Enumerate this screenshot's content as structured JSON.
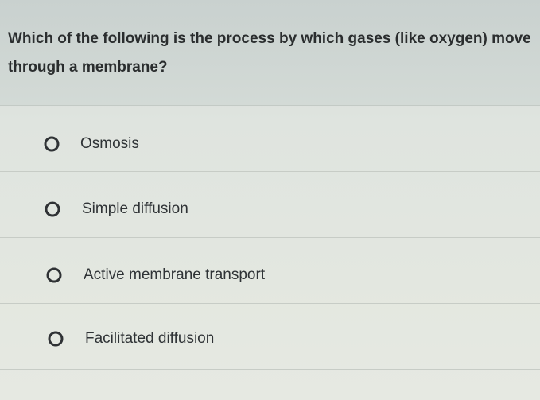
{
  "question": {
    "text": "Which of the following is the process by which gases (like oxygen) move through a membrane?"
  },
  "options": [
    {
      "label": "Osmosis",
      "selected": false
    },
    {
      "label": "Simple diffusion",
      "selected": false
    },
    {
      "label": "Active membrane transport",
      "selected": false
    },
    {
      "label": "Facilitated diffusion",
      "selected": false
    }
  ]
}
